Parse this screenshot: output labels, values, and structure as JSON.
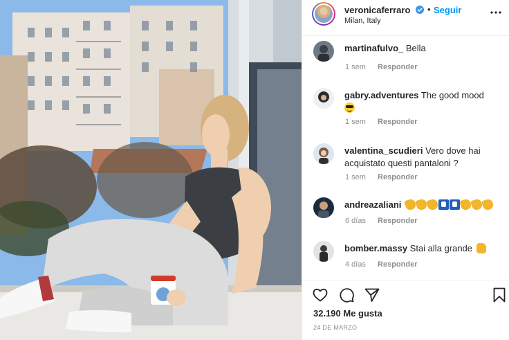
{
  "post": {
    "username": "veronicaferraro",
    "separator": "•",
    "follow_label": "Seguir",
    "location": "Milan, Italy"
  },
  "comments": [
    {
      "username": "martinafulvo_",
      "text": "Bella",
      "time": "1 sem",
      "reply_label": "Responder",
      "avatar_color": "#3b3f4a"
    },
    {
      "username": "gabry.adventures",
      "text": "The good mood",
      "emoji": "smiling-face-with-sunglasses",
      "time": "1 sem",
      "reply_label": "Responder",
      "avatar_color": "#2b2b2b"
    },
    {
      "username": "valentina_scudieri",
      "text": "Vero dove hai acquistato questi pantaloni ?",
      "time": "1 sem",
      "reply_label": "Responder",
      "avatar_color": "#c9b3a8"
    },
    {
      "username": "andreazaliani",
      "text": "",
      "emoji_sequence": [
        "clap",
        "clap",
        "clap",
        "blue-square",
        "blue-square",
        "clap",
        "clap",
        "clap"
      ],
      "time": "6 días",
      "reply_label": "Responder",
      "avatar_color": "#1e2a3a"
    },
    {
      "username": "bomber.massy",
      "text": "Stai alla grande",
      "emoji": "thumbs-up",
      "time": "4 días",
      "reply_label": "Responder",
      "avatar_color": "#b9b9b9"
    }
  ],
  "actions": {
    "like_icon": "heart-icon",
    "comment_icon": "comment-icon",
    "share_icon": "paper-plane-icon",
    "save_icon": "bookmark-icon"
  },
  "likes_text": "32.190 Me gusta",
  "date_text": "24 DE MARZO",
  "colors": {
    "accent": "#0095f6",
    "verified": "#3897f0",
    "text": "#262626",
    "muted": "#8e8e8e"
  }
}
